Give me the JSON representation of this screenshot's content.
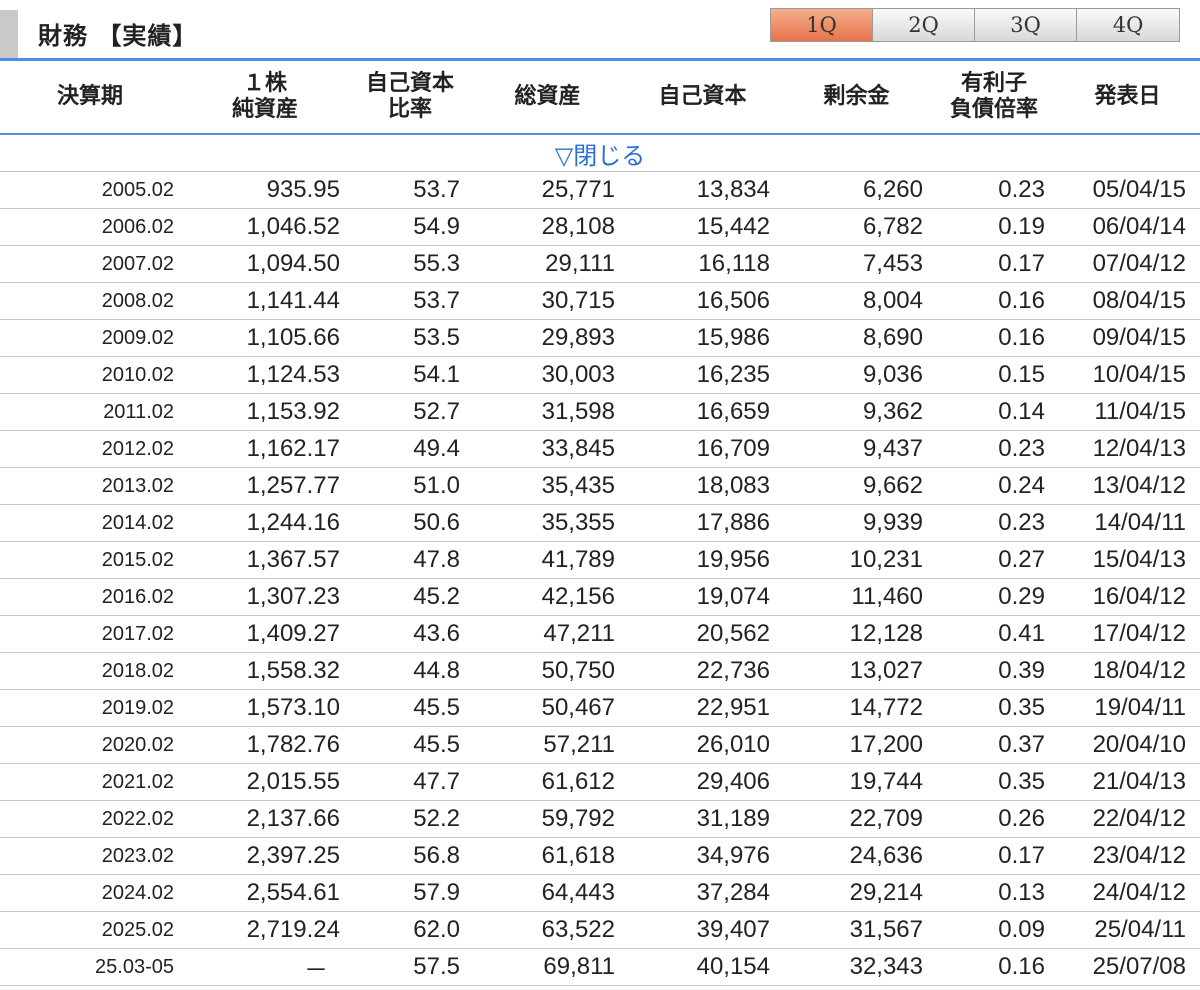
{
  "header": {
    "title": "財務 【実績】",
    "tabs": [
      {
        "label": "1Q",
        "active": true
      },
      {
        "label": "2Q",
        "active": false
      },
      {
        "label": "3Q",
        "active": false
      },
      {
        "label": "4Q",
        "active": false
      }
    ],
    "accent_color": "#e7714a",
    "rule_color": "#4a90e2"
  },
  "table": {
    "columns": [
      [
        "決算期"
      ],
      [
        "１株",
        "純資産"
      ],
      [
        "自己資本",
        "比率"
      ],
      [
        "総資産"
      ],
      [
        "自己資本"
      ],
      [
        "剰余金"
      ],
      [
        "有利子",
        "負債倍率"
      ],
      [
        "発表日"
      ]
    ],
    "toggle_label": "▽閉じる",
    "rows": [
      [
        "2005.02",
        "935.95",
        "53.7",
        "25,771",
        "13,834",
        "6,260",
        "0.23",
        "05/04/15"
      ],
      [
        "2006.02",
        "1,046.52",
        "54.9",
        "28,108",
        "15,442",
        "6,782",
        "0.19",
        "06/04/14"
      ],
      [
        "2007.02",
        "1,094.50",
        "55.3",
        "29,111",
        "16,118",
        "7,453",
        "0.17",
        "07/04/12"
      ],
      [
        "2008.02",
        "1,141.44",
        "53.7",
        "30,715",
        "16,506",
        "8,004",
        "0.16",
        "08/04/15"
      ],
      [
        "2009.02",
        "1,105.66",
        "53.5",
        "29,893",
        "15,986",
        "8,690",
        "0.16",
        "09/04/15"
      ],
      [
        "2010.02",
        "1,124.53",
        "54.1",
        "30,003",
        "16,235",
        "9,036",
        "0.15",
        "10/04/15"
      ],
      [
        "2011.02",
        "1,153.92",
        "52.7",
        "31,598",
        "16,659",
        "9,362",
        "0.14",
        "11/04/15"
      ],
      [
        "2012.02",
        "1,162.17",
        "49.4",
        "33,845",
        "16,709",
        "9,437",
        "0.23",
        "12/04/13"
      ],
      [
        "2013.02",
        "1,257.77",
        "51.0",
        "35,435",
        "18,083",
        "9,662",
        "0.24",
        "13/04/12"
      ],
      [
        "2014.02",
        "1,244.16",
        "50.6",
        "35,355",
        "17,886",
        "9,939",
        "0.23",
        "14/04/11"
      ],
      [
        "2015.02",
        "1,367.57",
        "47.8",
        "41,789",
        "19,956",
        "10,231",
        "0.27",
        "15/04/13"
      ],
      [
        "2016.02",
        "1,307.23",
        "45.2",
        "42,156",
        "19,074",
        "11,460",
        "0.29",
        "16/04/12"
      ],
      [
        "2017.02",
        "1,409.27",
        "43.6",
        "47,211",
        "20,562",
        "12,128",
        "0.41",
        "17/04/12"
      ],
      [
        "2018.02",
        "1,558.32",
        "44.8",
        "50,750",
        "22,736",
        "13,027",
        "0.39",
        "18/04/12"
      ],
      [
        "2019.02",
        "1,573.10",
        "45.5",
        "50,467",
        "22,951",
        "14,772",
        "0.35",
        "19/04/11"
      ],
      [
        "2020.02",
        "1,782.76",
        "45.5",
        "57,211",
        "26,010",
        "17,200",
        "0.37",
        "20/04/10"
      ],
      [
        "2021.02",
        "2,015.55",
        "47.7",
        "61,612",
        "29,406",
        "19,744",
        "0.35",
        "21/04/13"
      ],
      [
        "2022.02",
        "2,137.66",
        "52.2",
        "59,792",
        "31,189",
        "22,709",
        "0.26",
        "22/04/12"
      ],
      [
        "2023.02",
        "2,397.25",
        "56.8",
        "61,618",
        "34,976",
        "24,636",
        "0.17",
        "23/04/12"
      ],
      [
        "2024.02",
        "2,554.61",
        "57.9",
        "64,443",
        "37,284",
        "29,214",
        "0.13",
        "24/04/12"
      ],
      [
        "2025.02",
        "2,719.24",
        "62.0",
        "63,522",
        "39,407",
        "31,567",
        "0.09",
        "25/04/11"
      ],
      [
        "25.03-05",
        "－",
        "57.5",
        "69,811",
        "40,154",
        "32,343",
        "0.16",
        "25/07/08"
      ]
    ]
  }
}
